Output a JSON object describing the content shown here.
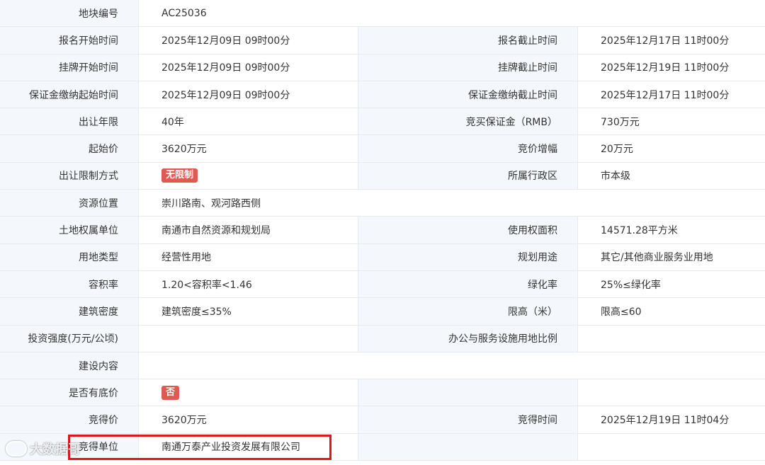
{
  "rows": [
    {
      "l1": "地块编号",
      "v1": "AC25036"
    },
    {
      "l1": "报名开始时间",
      "v1": "2025年12月09日 09时00分",
      "l2": "报名截止时间",
      "v2": "2025年12月17日 11时00分"
    },
    {
      "l1": "挂牌开始时间",
      "v1": "2025年12月09日 09时00分",
      "l2": "挂牌截止时间",
      "v2": "2025年12月19日 11时00分"
    },
    {
      "l1": "保证金缴纳起始时间",
      "v1": "2025年12月09日 09时00分",
      "l2": "保证金缴纳截止时间",
      "v2": "2025年12月17日 11时00分"
    },
    {
      "l1": "出让年限",
      "v1": "40年",
      "l2": "竞买保证金（RMB）",
      "v2": "730万元"
    },
    {
      "l1": "起始价",
      "v1": "3620万元",
      "l2": "竞价增幅",
      "v2": "20万元"
    },
    {
      "l1": "出让限制方式",
      "v1": "无限制",
      "l2": "所属行政区",
      "v2": "市本级"
    },
    {
      "l1": "资源位置",
      "v1": "崇川路南、观河路西侧"
    },
    {
      "l1": "土地权属单位",
      "v1": "南通市自然资源和规划局",
      "l2": "使用权面积",
      "v2": "14571.28平方米"
    },
    {
      "l1": "用地类型",
      "v1": "经营性用地",
      "l2": "规划用途",
      "v2": "其它/其他商业服务业用地"
    },
    {
      "l1": "容积率",
      "v1": "1.20<容积率<1.46",
      "l2": "绿化率",
      "v2": "25%≤绿化率"
    },
    {
      "l1": "建筑密度",
      "v1": "建筑密度≤35%",
      "l2": "限高（米）",
      "v2": "限高≤60"
    },
    {
      "l1": "投资强度(万元/公顷)",
      "v1": "",
      "l2": "办公与服务设施用地比例",
      "v2": ""
    },
    {
      "l1": "建设内容",
      "v1": ""
    },
    {
      "l1": "是否有底价",
      "v1": "否",
      "l2": "",
      "v2": ""
    },
    {
      "l1": "竞得价",
      "v1": "3620万元",
      "l2": "竞得时间",
      "v2": "2025年12月19日 11时04分"
    },
    {
      "l1": "竞得单位",
      "v1": "南通万泰产业投资发展有限公司",
      "l2": "",
      "v2": ""
    }
  ],
  "watermark": {
    "text": "大数据哥",
    "icon": "logo-icon"
  },
  "colors": {
    "label_bg": "#f4f8fc",
    "border": "#e6ebf0",
    "badge": "#e05a52",
    "highlight": "#e0161a"
  }
}
